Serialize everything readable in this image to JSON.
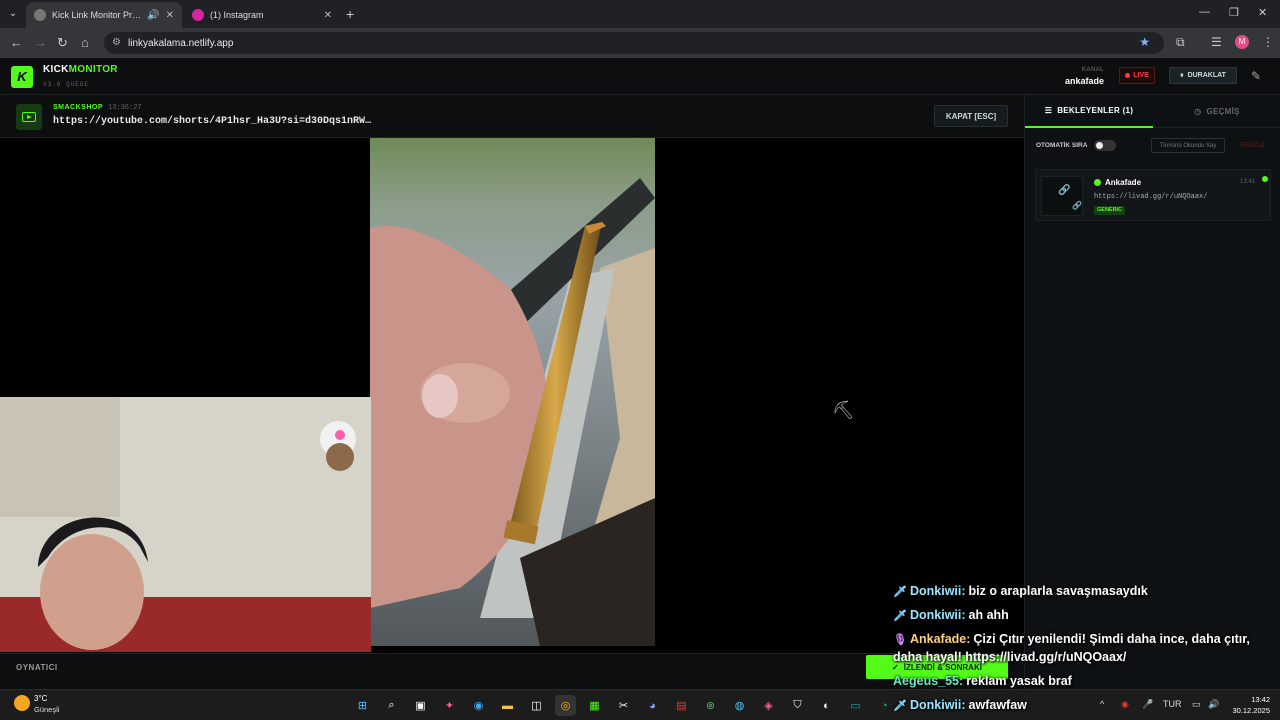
{
  "browser": {
    "tabs": [
      {
        "title": "Kick Link Monitor Pro | Stre",
        "active": true
      },
      {
        "title": "(1) Instagram",
        "active": false
      }
    ],
    "url": "linkyakalama.netlify.app",
    "profile_initial": "M"
  },
  "header": {
    "logo_letter": "K",
    "logo_a": "KICK",
    "logo_b": "MONITOR",
    "version": "V3.0 QUEUE",
    "kanal_label": "KANAL",
    "kanal_value": "ankafade",
    "live_label": "LIVE",
    "pause_label": "DURAKLAT"
  },
  "linkbar": {
    "source": "SMACKSHOP",
    "time": "13:36:27",
    "url": "https://youtube.com/shorts/4P1hsr_Ha3U?si=d30Dqs1nRW…",
    "close_label": "KAPAT [ESC]"
  },
  "player": {
    "bottom_label": "OYNATICI",
    "done_label": "İZLENDİ & SONRAKİ"
  },
  "panel": {
    "tab_waiting": "BEKLEYENLER (1)",
    "tab_history": "GEÇMİŞ",
    "auto_label": "OTOMATİK SIRA",
    "mark_all": "Tümünü Okundu Say",
    "clear": "TEMİZLE",
    "queue": [
      {
        "user": "Ankafade",
        "url": "https://livad.gg/r/uNQOaax/",
        "tag": "GENERIC",
        "time": "13:41"
      }
    ]
  },
  "chat": [
    {
      "user": "Donkiwii:",
      "text": "biz o araplarla savaşmasaydık",
      "color": "#9be7ff",
      "icon": "sword"
    },
    {
      "user": "Donkiwii:",
      "text": "ah ahh",
      "color": "#9be7ff",
      "icon": "sword"
    },
    {
      "user": "Ankafade:",
      "text": "Çizi Çıtır yenilendi! Şimdi daha ince, daha çıtır,",
      "color": "#ffd27a",
      "icon": "mic"
    },
    {
      "user": "",
      "text": "daha hayal! https://livad.gg/r/uNQOaax/",
      "color": "#ffffff",
      "icon": ""
    },
    {
      "user": "Aegeus_55:",
      "text": "reklam yasak braf",
      "color": "#6ee7c8",
      "icon": ""
    },
    {
      "user": "Donkiwii:",
      "text": "awfawfaw",
      "color": "#9be7ff",
      "icon": "sword"
    }
  ],
  "taskbar": {
    "temp": "3°C",
    "weather": "Güneşli",
    "lang": "TUR",
    "time": "13:42",
    "date": "30.12.2025"
  },
  "colors": {
    "accent": "#53fc18",
    "live": "#ff3b3b"
  }
}
